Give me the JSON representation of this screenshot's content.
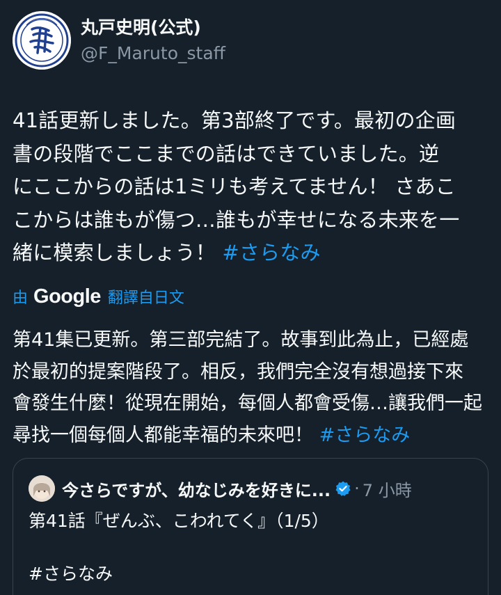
{
  "author": {
    "display_name": "丸戸史明(公式)",
    "handle": "@F_Maruto_staff",
    "avatar_icon": "seal-logo-avatar"
  },
  "tweet": {
    "text_lines": [
      "41話更新しました。第3部終了です。最初の企画",
      "書の段階でここまでの話はできていました。逆",
      "にここからの話は1ミリも考えてません！ さあこ",
      "こからは誰もが傷つ…誰もが幸せになる未来を一",
      "緒に模索しましょう！ "
    ],
    "hashtag": "#さらなみ"
  },
  "translation": {
    "by_label": "由",
    "provider": "Google",
    "from_label": "翻譯自日文",
    "text_lines": [
      "第41集已更新。第三部完結了。故事到此為止，已經處",
      "於最初的提案階段了。相反，我們完全沒有想過接下來",
      "會發生什麼！從現在開始，每個人都會受傷…讓我們一起",
      "尋找一個每個人都能幸福的未來吧！ "
    ],
    "hashtag": "#さらなみ"
  },
  "quote": {
    "name": "今さらですが、幼なじみを好きに...",
    "separator": "·",
    "time": "7 小時",
    "body": "第41話『ぜんぶ、こわれてく』（1/5）",
    "hashtag": "#さらなみ",
    "verified_color": "#1d9bf0"
  },
  "colors": {
    "background": "#15202b",
    "accent": "#1d9bf0",
    "text": "#f7f9f9",
    "muted": "#8b98a5",
    "border": "#38444d"
  }
}
